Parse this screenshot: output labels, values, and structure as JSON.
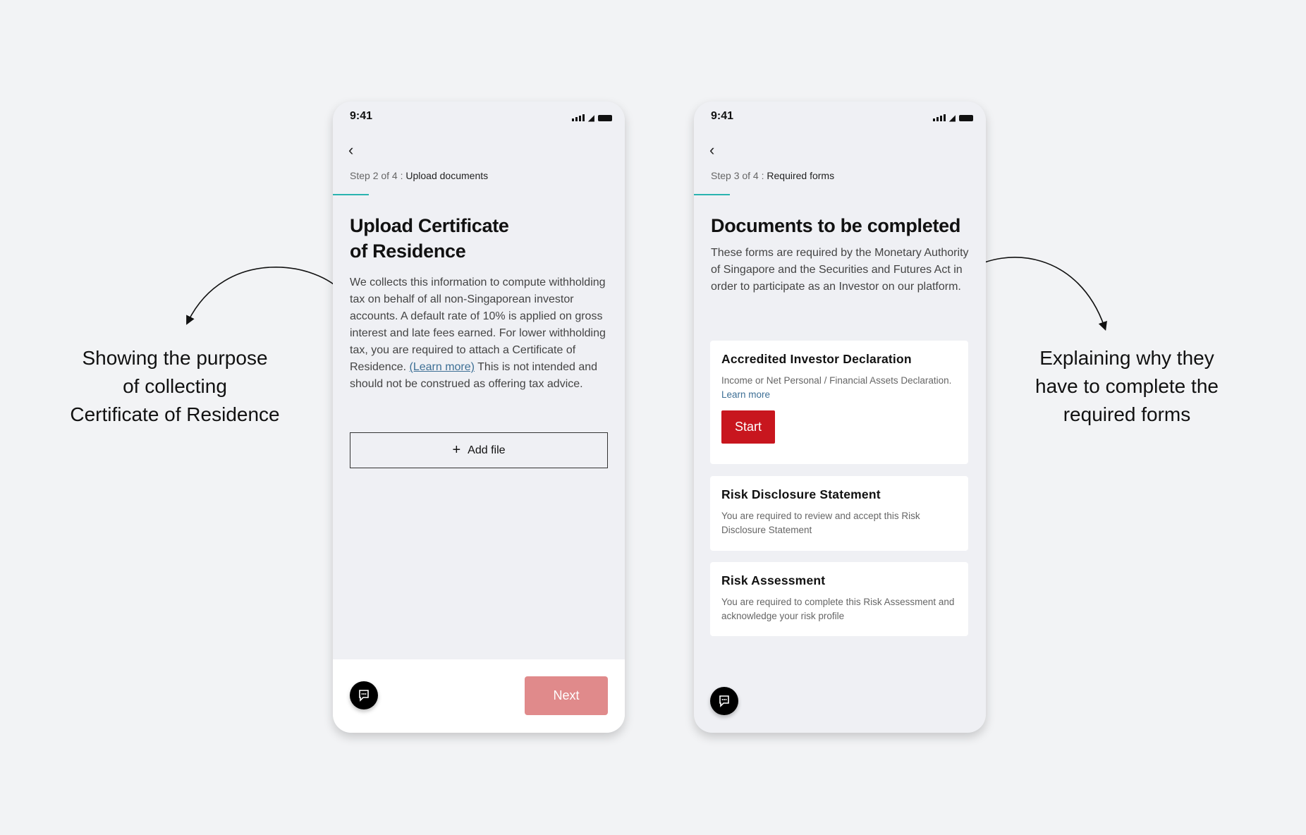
{
  "left_phone": {
    "time": "9:41",
    "step_prefix": "Step 2 of 4 : ",
    "step_name": "Upload documents",
    "title_line1": "Upload Certificate",
    "title_line2": "of Residence",
    "body_before_link": "We collects this information to compute withholding tax on behalf of all non-Singaporean investor accounts. A default rate of 10% is applied on gross interest and late fees earned. For lower withholding tax, you are required to attach a Certificate of Residence. ",
    "link": "(Learn more)",
    "body_after_link": "This is not intended and should not be construed as offering tax advice.",
    "add_file": "Add file",
    "next": "Next"
  },
  "right_phone": {
    "time": "9:41",
    "step_prefix": "Step 3 of 4 : ",
    "step_name": "Required forms",
    "title": "Documents to be completed",
    "body": "These forms are required by the Monetary Authority of Singapore and the Securities and Futures Act in order to participate as an Investor on our platform.",
    "cards": [
      {
        "title": "Accredited Investor Declaration",
        "desc": "Income or Net Personal / Financial Assets Declaration. ",
        "link": "Learn more",
        "button": "Start"
      },
      {
        "title": "Risk Disclosure Statement",
        "desc": "You are required to review and accept this Risk Disclosure Statement"
      },
      {
        "title": "Risk Assessment",
        "desc": "You are required to complete this Risk Assessment and acknowledge your risk profile"
      }
    ]
  },
  "annotations": {
    "left": [
      "Showing the purpose",
      "of collecting",
      "Certificate of Residence"
    ],
    "right": [
      "Explaining why they",
      "have to complete the",
      "required forms"
    ]
  },
  "colors": {
    "accent_teal": "#2ab3b0",
    "primary_red": "#c8161e",
    "disabled_red": "#e08a8b",
    "link": "#3d6f95"
  }
}
